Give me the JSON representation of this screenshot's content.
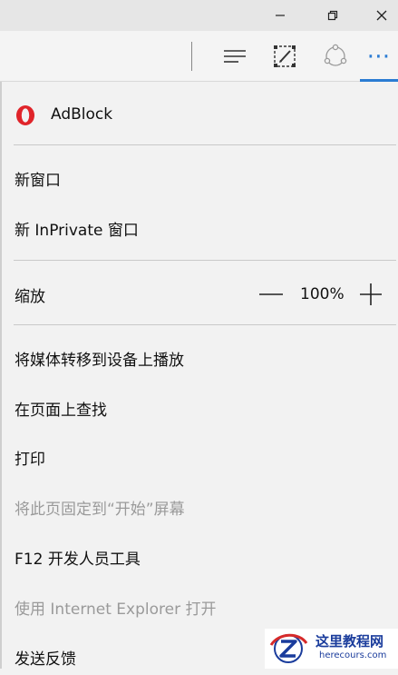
{
  "window_controls": {
    "minimize": "—",
    "maximize": "❐",
    "close": "✕"
  },
  "toolbar": {
    "more_label": "⋯"
  },
  "menu": {
    "adblock_label": "AdBlock",
    "new_window": "新窗口",
    "new_inprivate": "新 InPrivate 窗口",
    "zoom_label": "缩放",
    "zoom_minus": "—",
    "zoom_value": "100%",
    "zoom_plus": "+",
    "cast_media": "将媒体转移到设备上播放",
    "find_on_page": "在页面上查找",
    "print": "打印",
    "pin_to_start": "将此页固定到“开始”屏幕",
    "dev_tools": "F12 开发人员工具",
    "open_ie": "使用 Internet Explorer 打开",
    "feedback": "发送反馈"
  },
  "watermark": {
    "title": "这里教程网",
    "url": "herecours.com"
  },
  "colors": {
    "accent": "#2b7cd3",
    "adblock_red": "#e0242a",
    "watermark_blue": "#1a3c9c",
    "disabled_text": "#9a9a9a"
  }
}
